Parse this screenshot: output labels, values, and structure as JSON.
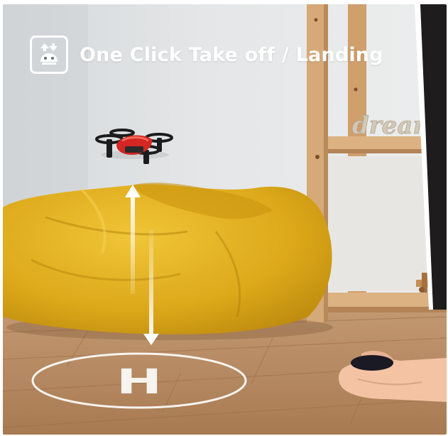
{
  "banner": {
    "title": "One Click Take off / Landing",
    "icon": "takeoff-landing-icon"
  },
  "scene": {
    "shelf_sign": "dream",
    "helipad_letter": "H"
  },
  "colors": {
    "wall": "#dfe2e4",
    "floor": "#b68a62",
    "beanbag": "#e1b01c",
    "drone_red": "#d42622",
    "shelf_wood": "#d9ad7c",
    "text": "#ffffff"
  }
}
